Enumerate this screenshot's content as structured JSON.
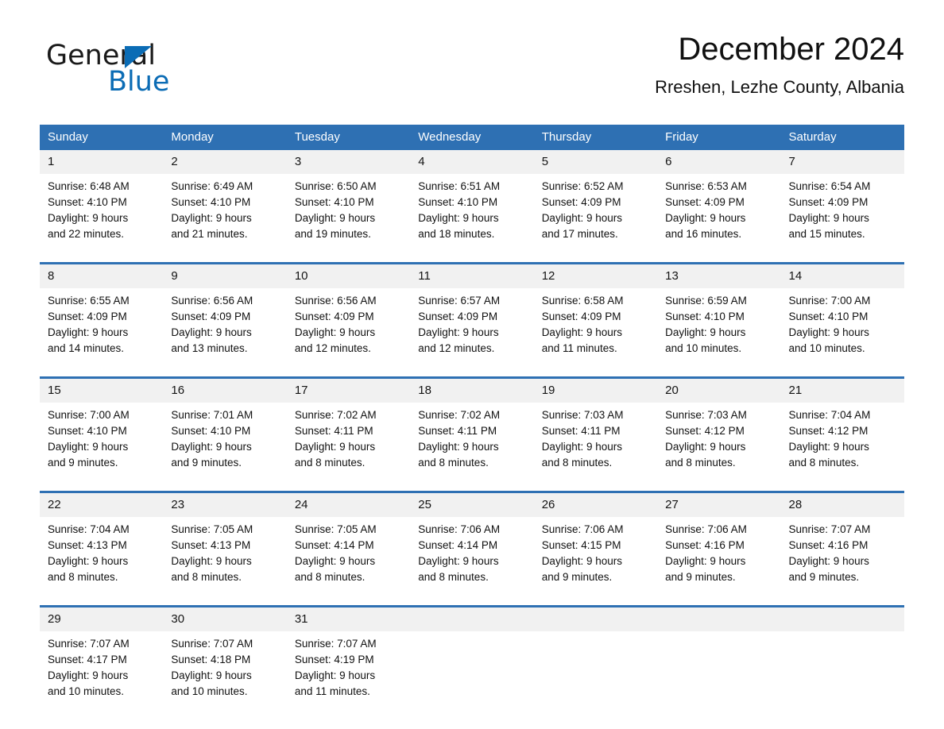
{
  "brand": {
    "logo_text_1": "General",
    "logo_text_2": "Blue",
    "triangle_icon": "blue-triangle-icon",
    "accent_color": "#0b6cb5"
  },
  "header": {
    "title": "December 2024",
    "subtitle": "Rreshen, Lezhe County, Albania"
  },
  "colors": {
    "header_blue": "#2e70b3",
    "day_band_gray": "#f1f1f1",
    "row_divider": "#2e70b3"
  },
  "weekdays": [
    "Sunday",
    "Monday",
    "Tuesday",
    "Wednesday",
    "Thursday",
    "Friday",
    "Saturday"
  ],
  "weeks": [
    [
      {
        "day": "1",
        "sunrise": "Sunrise: 6:48 AM",
        "sunset": "Sunset: 4:10 PM",
        "daylight_1": "Daylight: 9 hours",
        "daylight_2": "and 22 minutes."
      },
      {
        "day": "2",
        "sunrise": "Sunrise: 6:49 AM",
        "sunset": "Sunset: 4:10 PM",
        "daylight_1": "Daylight: 9 hours",
        "daylight_2": "and 21 minutes."
      },
      {
        "day": "3",
        "sunrise": "Sunrise: 6:50 AM",
        "sunset": "Sunset: 4:10 PM",
        "daylight_1": "Daylight: 9 hours",
        "daylight_2": "and 19 minutes."
      },
      {
        "day": "4",
        "sunrise": "Sunrise: 6:51 AM",
        "sunset": "Sunset: 4:10 PM",
        "daylight_1": "Daylight: 9 hours",
        "daylight_2": "and 18 minutes."
      },
      {
        "day": "5",
        "sunrise": "Sunrise: 6:52 AM",
        "sunset": "Sunset: 4:09 PM",
        "daylight_1": "Daylight: 9 hours",
        "daylight_2": "and 17 minutes."
      },
      {
        "day": "6",
        "sunrise": "Sunrise: 6:53 AM",
        "sunset": "Sunset: 4:09 PM",
        "daylight_1": "Daylight: 9 hours",
        "daylight_2": "and 16 minutes."
      },
      {
        "day": "7",
        "sunrise": "Sunrise: 6:54 AM",
        "sunset": "Sunset: 4:09 PM",
        "daylight_1": "Daylight: 9 hours",
        "daylight_2": "and 15 minutes."
      }
    ],
    [
      {
        "day": "8",
        "sunrise": "Sunrise: 6:55 AM",
        "sunset": "Sunset: 4:09 PM",
        "daylight_1": "Daylight: 9 hours",
        "daylight_2": "and 14 minutes."
      },
      {
        "day": "9",
        "sunrise": "Sunrise: 6:56 AM",
        "sunset": "Sunset: 4:09 PM",
        "daylight_1": "Daylight: 9 hours",
        "daylight_2": "and 13 minutes."
      },
      {
        "day": "10",
        "sunrise": "Sunrise: 6:56 AM",
        "sunset": "Sunset: 4:09 PM",
        "daylight_1": "Daylight: 9 hours",
        "daylight_2": "and 12 minutes."
      },
      {
        "day": "11",
        "sunrise": "Sunrise: 6:57 AM",
        "sunset": "Sunset: 4:09 PM",
        "daylight_1": "Daylight: 9 hours",
        "daylight_2": "and 12 minutes."
      },
      {
        "day": "12",
        "sunrise": "Sunrise: 6:58 AM",
        "sunset": "Sunset: 4:09 PM",
        "daylight_1": "Daylight: 9 hours",
        "daylight_2": "and 11 minutes."
      },
      {
        "day": "13",
        "sunrise": "Sunrise: 6:59 AM",
        "sunset": "Sunset: 4:10 PM",
        "daylight_1": "Daylight: 9 hours",
        "daylight_2": "and 10 minutes."
      },
      {
        "day": "14",
        "sunrise": "Sunrise: 7:00 AM",
        "sunset": "Sunset: 4:10 PM",
        "daylight_1": "Daylight: 9 hours",
        "daylight_2": "and 10 minutes."
      }
    ],
    [
      {
        "day": "15",
        "sunrise": "Sunrise: 7:00 AM",
        "sunset": "Sunset: 4:10 PM",
        "daylight_1": "Daylight: 9 hours",
        "daylight_2": "and 9 minutes."
      },
      {
        "day": "16",
        "sunrise": "Sunrise: 7:01 AM",
        "sunset": "Sunset: 4:10 PM",
        "daylight_1": "Daylight: 9 hours",
        "daylight_2": "and 9 minutes."
      },
      {
        "day": "17",
        "sunrise": "Sunrise: 7:02 AM",
        "sunset": "Sunset: 4:11 PM",
        "daylight_1": "Daylight: 9 hours",
        "daylight_2": "and 8 minutes."
      },
      {
        "day": "18",
        "sunrise": "Sunrise: 7:02 AM",
        "sunset": "Sunset: 4:11 PM",
        "daylight_1": "Daylight: 9 hours",
        "daylight_2": "and 8 minutes."
      },
      {
        "day": "19",
        "sunrise": "Sunrise: 7:03 AM",
        "sunset": "Sunset: 4:11 PM",
        "daylight_1": "Daylight: 9 hours",
        "daylight_2": "and 8 minutes."
      },
      {
        "day": "20",
        "sunrise": "Sunrise: 7:03 AM",
        "sunset": "Sunset: 4:12 PM",
        "daylight_1": "Daylight: 9 hours",
        "daylight_2": "and 8 minutes."
      },
      {
        "day": "21",
        "sunrise": "Sunrise: 7:04 AM",
        "sunset": "Sunset: 4:12 PM",
        "daylight_1": "Daylight: 9 hours",
        "daylight_2": "and 8 minutes."
      }
    ],
    [
      {
        "day": "22",
        "sunrise": "Sunrise: 7:04 AM",
        "sunset": "Sunset: 4:13 PM",
        "daylight_1": "Daylight: 9 hours",
        "daylight_2": "and 8 minutes."
      },
      {
        "day": "23",
        "sunrise": "Sunrise: 7:05 AM",
        "sunset": "Sunset: 4:13 PM",
        "daylight_1": "Daylight: 9 hours",
        "daylight_2": "and 8 minutes."
      },
      {
        "day": "24",
        "sunrise": "Sunrise: 7:05 AM",
        "sunset": "Sunset: 4:14 PM",
        "daylight_1": "Daylight: 9 hours",
        "daylight_2": "and 8 minutes."
      },
      {
        "day": "25",
        "sunrise": "Sunrise: 7:06 AM",
        "sunset": "Sunset: 4:14 PM",
        "daylight_1": "Daylight: 9 hours",
        "daylight_2": "and 8 minutes."
      },
      {
        "day": "26",
        "sunrise": "Sunrise: 7:06 AM",
        "sunset": "Sunset: 4:15 PM",
        "daylight_1": "Daylight: 9 hours",
        "daylight_2": "and 9 minutes."
      },
      {
        "day": "27",
        "sunrise": "Sunrise: 7:06 AM",
        "sunset": "Sunset: 4:16 PM",
        "daylight_1": "Daylight: 9 hours",
        "daylight_2": "and 9 minutes."
      },
      {
        "day": "28",
        "sunrise": "Sunrise: 7:07 AM",
        "sunset": "Sunset: 4:16 PM",
        "daylight_1": "Daylight: 9 hours",
        "daylight_2": "and 9 minutes."
      }
    ],
    [
      {
        "day": "29",
        "sunrise": "Sunrise: 7:07 AM",
        "sunset": "Sunset: 4:17 PM",
        "daylight_1": "Daylight: 9 hours",
        "daylight_2": "and 10 minutes."
      },
      {
        "day": "30",
        "sunrise": "Sunrise: 7:07 AM",
        "sunset": "Sunset: 4:18 PM",
        "daylight_1": "Daylight: 9 hours",
        "daylight_2": "and 10 minutes."
      },
      {
        "day": "31",
        "sunrise": "Sunrise: 7:07 AM",
        "sunset": "Sunset: 4:19 PM",
        "daylight_1": "Daylight: 9 hours",
        "daylight_2": "and 11 minutes."
      },
      {
        "day": "",
        "sunrise": "",
        "sunset": "",
        "daylight_1": "",
        "daylight_2": ""
      },
      {
        "day": "",
        "sunrise": "",
        "sunset": "",
        "daylight_1": "",
        "daylight_2": ""
      },
      {
        "day": "",
        "sunrise": "",
        "sunset": "",
        "daylight_1": "",
        "daylight_2": ""
      },
      {
        "day": "",
        "sunrise": "",
        "sunset": "",
        "daylight_1": "",
        "daylight_2": ""
      }
    ]
  ]
}
